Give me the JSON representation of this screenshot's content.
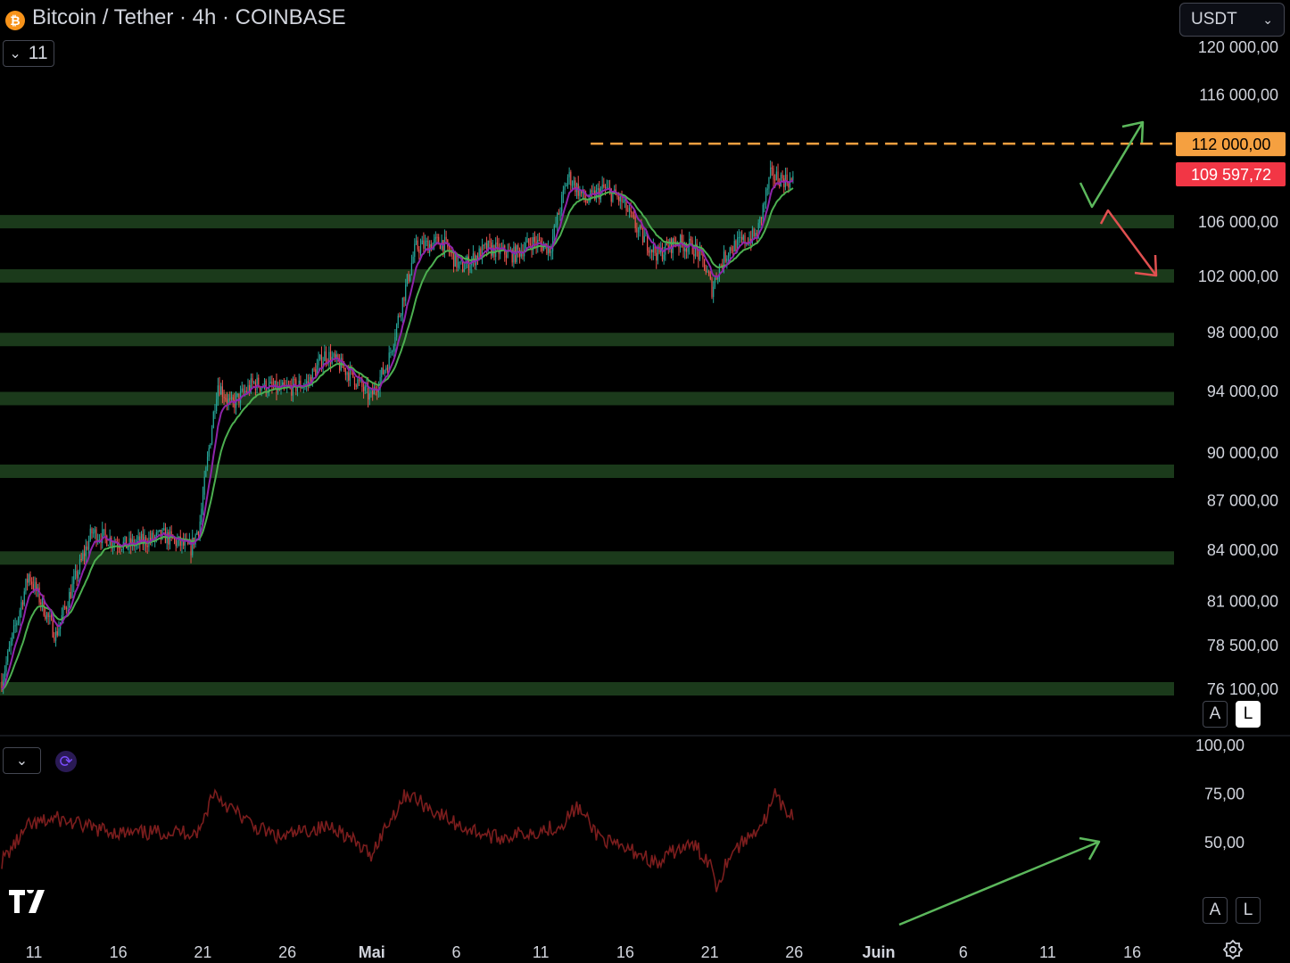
{
  "header": {
    "title": "Bitcoin / Tether · 4h · COINBASE",
    "coin_icon": "bitcoin-icon",
    "indicator_count": "11"
  },
  "currency_select": {
    "value": "USDT"
  },
  "scale_buttons": {
    "auto": "A",
    "log": "L"
  },
  "rsi_panel": {
    "toggle_icon": "chevron-down-icon",
    "sync_icon": "sync-icon"
  },
  "colors": {
    "bull": "#26a69a",
    "bear": "#ef5350",
    "ema_fast": "#8e24aa",
    "ema_slow": "#4caf50",
    "zone": "#1b3a1b",
    "resistance": "#f5a040",
    "rsi_line": "#7b1d1d",
    "arrow_up": "#5cb85c",
    "arrow_down": "#e05050"
  },
  "chart_data": [
    {
      "type": "candlestick",
      "title": "Bitcoin / Tether · 4h · COINBASE",
      "x_ticks": [
        "11",
        "16",
        "21",
        "26",
        "Mai",
        "6",
        "11",
        "16",
        "21",
        "26",
        "Juin",
        "6",
        "11",
        "16"
      ],
      "y_ticks": [
        "120 000,00",
        "116 000,00",
        "112 000,00",
        "106 000,00",
        "102 000,00",
        "98 000,00",
        "94 000,00",
        "90 000,00",
        "87 000,00",
        "84 000,00",
        "81 000,00",
        "78 500,00",
        "76 100,00"
      ],
      "price_labels": {
        "resistance": "112 000,00",
        "last": "109 597,72"
      },
      "resistance_level": 112000,
      "support_zones": [
        106000,
        102000,
        97500,
        93500,
        88800,
        83500,
        76100
      ],
      "scale": "log",
      "series": [
        {
          "points": [
            [
              0,
              76500
            ],
            [
              3,
              82500
            ],
            [
              6,
              79000
            ],
            [
              10,
              85000
            ],
            [
              14,
              84200
            ],
            [
              18,
              84800
            ],
            [
              21,
              84000
            ],
            [
              22,
              85500
            ],
            [
              24,
              94500
            ],
            [
              25.5,
              93000
            ],
            [
              28,
              94500
            ],
            [
              31,
              94000
            ],
            [
              34,
              94500
            ],
            [
              36,
              96500
            ],
            [
              37,
              96000
            ],
            [
              39,
              95000
            ],
            [
              41,
              93500
            ],
            [
              43,
              96000
            ],
            [
              46,
              104000
            ],
            [
              49,
              104500
            ],
            [
              51,
              102500
            ],
            [
              54,
              104000
            ],
            [
              57,
              103500
            ],
            [
              59,
              104500
            ],
            [
              61,
              104000
            ],
            [
              63,
              109500
            ],
            [
              65,
              107500
            ],
            [
              67,
              108500
            ],
            [
              69,
              107500
            ],
            [
              71,
              105000
            ],
            [
              73,
              103500
            ],
            [
              75,
              104500
            ],
            [
              77,
              104000
            ],
            [
              78,
              103000
            ],
            [
              79,
              101000
            ],
            [
              79.7,
              102500
            ],
            [
              81,
              104000
            ],
            [
              84,
              105000
            ],
            [
              85.5,
              109500
            ],
            [
              87,
              109200
            ],
            [
              88,
              109000
            ]
          ]
        }
      ]
    },
    {
      "type": "line",
      "title": "",
      "y_ticks": [
        "100,00",
        "75,00",
        "50,00"
      ],
      "ylim": [
        0,
        100
      ],
      "series": [
        {
          "points": [
            [
              0,
              40
            ],
            [
              3,
              58
            ],
            [
              6,
              62
            ],
            [
              10,
              57
            ],
            [
              14,
              54
            ],
            [
              18,
              55
            ],
            [
              22,
              55
            ],
            [
              23.5,
              76
            ],
            [
              25,
              69
            ],
            [
              28,
              58
            ],
            [
              31,
              52
            ],
            [
              34,
              56
            ],
            [
              37,
              58
            ],
            [
              41,
              43
            ],
            [
              43,
              60
            ],
            [
              45,
              75
            ],
            [
              48,
              66
            ],
            [
              51,
              58
            ],
            [
              55,
              52
            ],
            [
              59,
              55
            ],
            [
              62,
              58
            ],
            [
              64,
              68
            ],
            [
              66,
              55
            ],
            [
              68,
              48
            ],
            [
              71,
              44
            ],
            [
              73,
              38
            ],
            [
              75,
              46
            ],
            [
              77,
              48
            ],
            [
              79,
              38
            ],
            [
              79.5,
              27
            ],
            [
              81,
              44
            ],
            [
              83,
              52
            ],
            [
              85,
              62
            ],
            [
              86,
              74
            ],
            [
              87,
              66
            ],
            [
              88,
              64
            ]
          ]
        }
      ]
    }
  ]
}
